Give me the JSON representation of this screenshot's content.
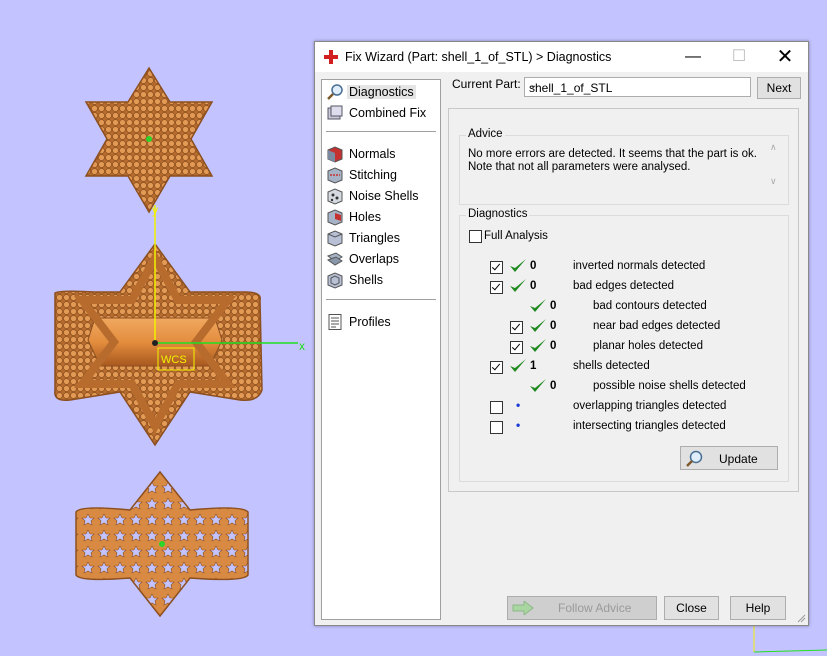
{
  "viewport": {
    "axis_y_label": "y",
    "axis_x_label": "x",
    "wcs_label": "WCS"
  },
  "dialog": {
    "title": "Fix Wizard (Part: shell_1_of_STL) > Diagnostics",
    "window_buttons": {
      "minimize": "—",
      "maximize": "☐",
      "close": "✕"
    },
    "nav": {
      "group1": [
        {
          "label": "Diagnostics",
          "icon": "magnifier-icon",
          "selected": true
        },
        {
          "label": "Combined Fix",
          "icon": "combined-fix-icon"
        }
      ],
      "group2": [
        {
          "label": "Normals",
          "icon": "normals-icon"
        },
        {
          "label": "Stitching",
          "icon": "stitching-icon"
        },
        {
          "label": "Noise Shells",
          "icon": "noise-shells-icon"
        },
        {
          "label": "Holes",
          "icon": "holes-icon"
        },
        {
          "label": "Triangles",
          "icon": "triangles-icon"
        },
        {
          "label": "Overlaps",
          "icon": "overlaps-icon"
        },
        {
          "label": "Shells",
          "icon": "shells-icon"
        }
      ],
      "group3": [
        {
          "label": "Profiles",
          "icon": "profiles-icon"
        }
      ]
    },
    "current_part_label": "Current Part:",
    "current_part_value": "shell_1_of_STL",
    "next_label": "Next",
    "advice": {
      "title": "Advice",
      "text": "No more errors are detected. It seems that the part is ok. Note that not all parameters were analysed."
    },
    "diagnostics": {
      "title": "Diagnostics",
      "full_analysis_label": "Full Analysis",
      "full_analysis_checked": false,
      "rows": [
        {
          "indent": 0,
          "checkbox": true,
          "checked": true,
          "status": "ok",
          "count": "0",
          "label": "inverted normals detected"
        },
        {
          "indent": 0,
          "checkbox": true,
          "checked": true,
          "status": "ok",
          "count": "0",
          "label": "bad edges detected"
        },
        {
          "indent": 1,
          "checkbox": false,
          "checked": false,
          "status": "ok",
          "count": "0",
          "label": "bad contours detected"
        },
        {
          "indent": 1,
          "checkbox": true,
          "checked": true,
          "status": "ok",
          "count": "0",
          "label": "near bad edges detected"
        },
        {
          "indent": 1,
          "checkbox": true,
          "checked": true,
          "status": "ok",
          "count": "0",
          "label": "planar holes detected"
        },
        {
          "indent": 0,
          "checkbox": true,
          "checked": true,
          "status": "ok",
          "count": "1",
          "label": "shells detected"
        },
        {
          "indent": 1,
          "checkbox": false,
          "checked": false,
          "status": "ok",
          "count": "0",
          "label": "possible noise shells detected"
        },
        {
          "indent": 0,
          "checkbox": true,
          "checked": false,
          "status": "pending",
          "count": "",
          "label": "overlapping triangles detected"
        },
        {
          "indent": 0,
          "checkbox": true,
          "checked": false,
          "status": "pending",
          "count": "",
          "label": "intersecting triangles detected"
        }
      ],
      "update_label": "Update"
    },
    "buttons": {
      "follow_advice": "Follow Advice",
      "close": "Close",
      "help": "Help"
    },
    "colors": {
      "check_green": "#1f8a1f",
      "pending_blue": "#1b3bd6",
      "viewport_bg": "#c3c3ff",
      "ring_copper": "#d2813a"
    }
  }
}
